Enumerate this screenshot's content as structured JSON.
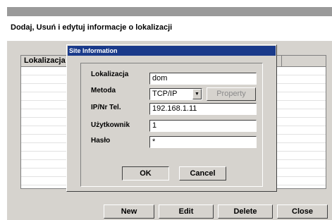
{
  "header": {
    "title": "Dodaj, Usuń i edytuj informacje o lokalizacji"
  },
  "list": {
    "columns": [
      "Lokalizacja"
    ]
  },
  "buttons": {
    "new": "New",
    "edit": "Edit",
    "delete": "Delete",
    "close": "Close"
  },
  "dialog": {
    "title": "Site Information",
    "labels": {
      "location": "Lokalizacja",
      "method": "Metoda",
      "ip": "IP/Nr Tel.",
      "user": "Użytkownik",
      "password": "Hasło"
    },
    "values": {
      "location": "dom",
      "method": "TCP/IP",
      "ip": "192.168.1.11",
      "user": "1",
      "password": "*"
    },
    "property_label": "Property",
    "ok_label": "OK",
    "cancel_label": "Cancel"
  },
  "colors": {
    "title_bar": "#1a3a8a",
    "face": "#d6d3ce"
  },
  "icons": {
    "method_dropdown": "chevron-down-icon"
  }
}
